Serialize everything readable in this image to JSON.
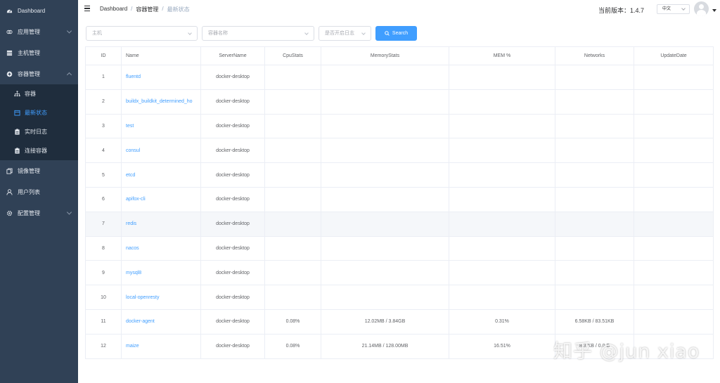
{
  "sidebar": {
    "items": [
      {
        "label": "Dashboard",
        "icon": "dashboard-icon"
      },
      {
        "label": "应用管理",
        "icon": "app-icon",
        "expandable": true
      },
      {
        "label": "主机管理",
        "icon": "host-icon"
      },
      {
        "label": "容器管理",
        "icon": "container-icon",
        "expanded": true
      }
    ],
    "submenu": [
      {
        "label": "容器",
        "icon": "tree-icon"
      },
      {
        "label": "最新状态",
        "icon": "calendar-icon",
        "active": true
      },
      {
        "label": "实时日志",
        "icon": "clipboard-icon"
      },
      {
        "label": "连接容器",
        "icon": "clipboard-icon"
      }
    ],
    "items_after": [
      {
        "label": "镜像管理",
        "icon": "copy-icon"
      },
      {
        "label": "用户列表",
        "icon": "user-icon"
      },
      {
        "label": "配置管理",
        "icon": "gear-icon",
        "expandable": true
      }
    ]
  },
  "header": {
    "breadcrumb": [
      "Dashboard",
      "容器管理",
      "最新状态"
    ],
    "version": "当前版本：1.4.7",
    "language": "中文"
  },
  "filters": {
    "host_placeholder": "主机",
    "container_placeholder": "容器名称",
    "enabled_placeholder": "是否开启日志",
    "search_label": "Search"
  },
  "table": {
    "columns": [
      "ID",
      "Name",
      "ServerName",
      "CpuStats",
      "MemoryStats",
      "MEM %",
      "Networks",
      "UpdateDate"
    ],
    "rows": [
      {
        "id": "1",
        "name": "fluentd",
        "server": "docker-desktop",
        "cpu": "",
        "mem": "",
        "mem_pct": "",
        "net": "",
        "date": ""
      },
      {
        "id": "2",
        "name": "buildx_buildkit_determined_ho",
        "server": "docker-desktop",
        "cpu": "",
        "mem": "",
        "mem_pct": "",
        "net": "",
        "date": ""
      },
      {
        "id": "3",
        "name": "test",
        "server": "docker-desktop",
        "cpu": "",
        "mem": "",
        "mem_pct": "",
        "net": "",
        "date": ""
      },
      {
        "id": "4",
        "name": "consul",
        "server": "docker-desktop",
        "cpu": "",
        "mem": "",
        "mem_pct": "",
        "net": "",
        "date": ""
      },
      {
        "id": "5",
        "name": "etcd",
        "server": "docker-desktop",
        "cpu": "",
        "mem": "",
        "mem_pct": "",
        "net": "",
        "date": ""
      },
      {
        "id": "6",
        "name": "apifox-cli",
        "server": "docker-desktop",
        "cpu": "",
        "mem": "",
        "mem_pct": "",
        "net": "",
        "date": ""
      },
      {
        "id": "7",
        "name": "redis",
        "server": "docker-desktop",
        "cpu": "",
        "mem": "",
        "mem_pct": "",
        "net": "",
        "date": ""
      },
      {
        "id": "8",
        "name": "nacos",
        "server": "docker-desktop",
        "cpu": "",
        "mem": "",
        "mem_pct": "",
        "net": "",
        "date": ""
      },
      {
        "id": "9",
        "name": "mysql8",
        "server": "docker-desktop",
        "cpu": "",
        "mem": "",
        "mem_pct": "",
        "net": "",
        "date": ""
      },
      {
        "id": "10",
        "name": "local-openresty",
        "server": "docker-desktop",
        "cpu": "",
        "mem": "",
        "mem_pct": "",
        "net": "",
        "date": ""
      },
      {
        "id": "11",
        "name": "docker-agent",
        "server": "docker-desktop",
        "cpu": "0.08%",
        "mem": "12.02MB / 3.84GB",
        "mem_pct": "0.31%",
        "net": "6.58KB / 83.51KB",
        "date": ""
      },
      {
        "id": "12",
        "name": "maize",
        "server": "docker-desktop",
        "cpu": "0.08%",
        "mem": "21.14MB / 128.00MB",
        "mem_pct": "16.51%",
        "net": "8.3 KB / 0.0 B",
        "date": ""
      }
    ]
  },
  "watermark": "知乎 @jun xiao",
  "colors": {
    "sidebar": "#304156",
    "submenu": "#1f2d3d",
    "accent": "#409eff"
  }
}
